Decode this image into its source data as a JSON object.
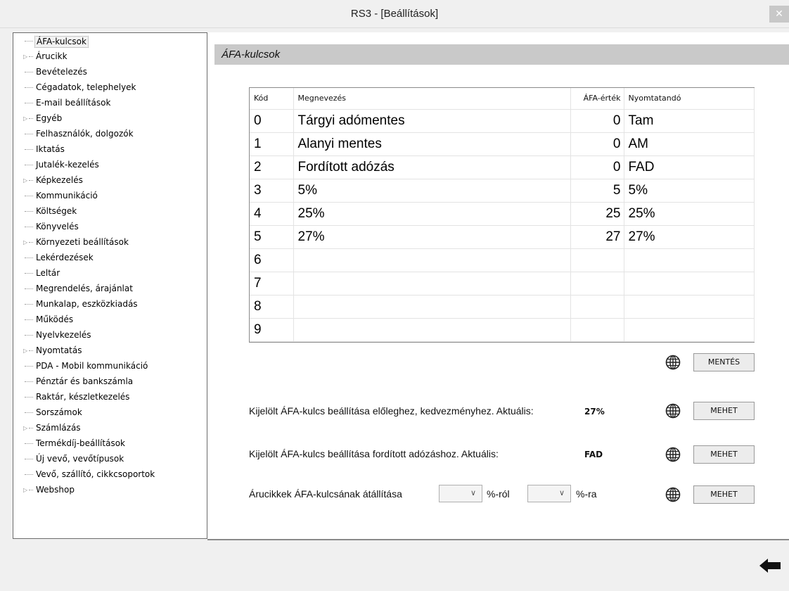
{
  "window": {
    "title": "RS3 - [Beállítások]",
    "close_glyph": "✕"
  },
  "sidebar": {
    "items": [
      {
        "label": "ÁFA-kulcsok",
        "expandable": false,
        "selected": true
      },
      {
        "label": "Árucikk",
        "expandable": true
      },
      {
        "label": "Bevételezés",
        "expandable": false
      },
      {
        "label": "Cégadatok, telephelyek",
        "expandable": false
      },
      {
        "label": "E-mail beállítások",
        "expandable": false
      },
      {
        "label": "Egyéb",
        "expandable": true
      },
      {
        "label": "Felhasználók, dolgozók",
        "expandable": false
      },
      {
        "label": "Iktatás",
        "expandable": false
      },
      {
        "label": "Jutalék-kezelés",
        "expandable": false
      },
      {
        "label": "Képkezelés",
        "expandable": true
      },
      {
        "label": "Kommunikáció",
        "expandable": false
      },
      {
        "label": "Költségek",
        "expandable": false
      },
      {
        "label": "Könyvelés",
        "expandable": false
      },
      {
        "label": "Környezeti beállítások",
        "expandable": true
      },
      {
        "label": "Lekérdezések",
        "expandable": false
      },
      {
        "label": "Leltár",
        "expandable": false
      },
      {
        "label": "Megrendelés, árajánlat",
        "expandable": false
      },
      {
        "label": "Munkalap, eszközkiadás",
        "expandable": false
      },
      {
        "label": "Működés",
        "expandable": false
      },
      {
        "label": "Nyelvkezelés",
        "expandable": false
      },
      {
        "label": "Nyomtatás",
        "expandable": true
      },
      {
        "label": "PDA - Mobil kommunikáció",
        "expandable": false
      },
      {
        "label": "Pénztár és bankszámla",
        "expandable": false
      },
      {
        "label": "Raktár, készletkezelés",
        "expandable": false
      },
      {
        "label": "Sorszámok",
        "expandable": false
      },
      {
        "label": "Számlázás",
        "expandable": true
      },
      {
        "label": "Termékdíj-beállítások",
        "expandable": false
      },
      {
        "label": "Új vevő, vevőtípusok",
        "expandable": false
      },
      {
        "label": "Vevő, szállító, cikkcsoportok",
        "expandable": false
      },
      {
        "label": "Webshop",
        "expandable": true
      }
    ]
  },
  "main": {
    "section_title": "ÁFA-kulcsok",
    "table": {
      "headers": {
        "code": "Kód",
        "name": "Megnevezés",
        "value": "ÁFA-érték",
        "print": "Nyomtatandó"
      },
      "rows": [
        {
          "code": "0",
          "name": "Tárgyi adómentes",
          "value": "0",
          "print": "Tam"
        },
        {
          "code": "1",
          "name": "Alanyi mentes",
          "value": "0",
          "print": "AM"
        },
        {
          "code": "2",
          "name": "Fordított adózás",
          "value": "0",
          "print": "FAD"
        },
        {
          "code": "3",
          "name": "5%",
          "value": "5",
          "print": "5%"
        },
        {
          "code": "4",
          "name": "25%",
          "value": "25",
          "print": "25%"
        },
        {
          "code": "5",
          "name": "27%",
          "value": "27",
          "print": "27%"
        },
        {
          "code": "6",
          "name": "",
          "value": "",
          "print": ""
        },
        {
          "code": "7",
          "name": "",
          "value": "",
          "print": ""
        },
        {
          "code": "8",
          "name": "",
          "value": "",
          "print": ""
        },
        {
          "code": "9",
          "name": "",
          "value": "",
          "print": ""
        }
      ]
    },
    "save_button": "MENTÉS",
    "advance_row": {
      "label": "Kijelölt ÁFA-kulcs beállítása előleghez, kedvezményhez. Aktuális:",
      "current": "27%",
      "button": "MEHET"
    },
    "reverse_row": {
      "label": "Kijelölt ÁFA-kulcs beállítása fordított adózáshoz. Aktuális:",
      "current": "FAD",
      "button": "MEHET"
    },
    "convert_row": {
      "label": "Árucikkek ÁFA-kulcsának átállítása",
      "from_value": "",
      "from_suffix": "%-ról",
      "to_value": "",
      "to_suffix": "%-ra",
      "button": "MEHET"
    }
  },
  "icons": {
    "globe": "globe-icon",
    "back": "back-arrow-icon",
    "expander": "triangle-right-icon"
  }
}
